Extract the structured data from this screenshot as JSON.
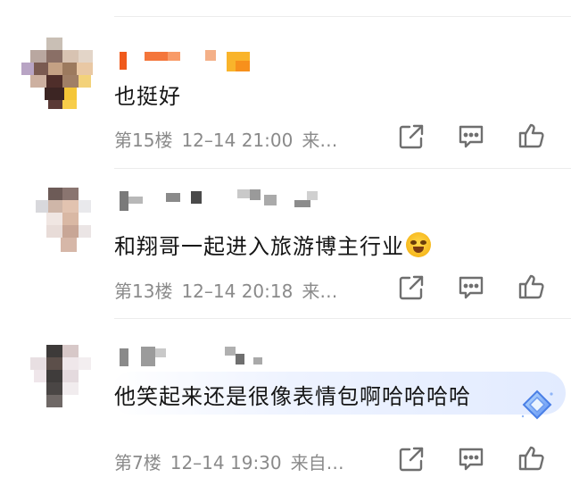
{
  "comments": [
    {
      "content": "也挺好",
      "floor": "第15楼",
      "time": "12–14 21:00",
      "source": "来…"
    },
    {
      "content": "和翔哥一起进入旅游博主行业",
      "floor": "第13楼",
      "time": "12–14 20:18",
      "source": "来…"
    },
    {
      "content": "他笑起来还是很像表情包啊哈哈哈哈",
      "floor": "第7楼",
      "time": "12–14 19:30",
      "source": "来自…"
    }
  ],
  "icons": {
    "share": "share-icon",
    "comment": "comment-icon",
    "like": "thumbs-up-icon",
    "emoji": "laughing-crying-emoji",
    "badge": "diamond-badge-icon"
  },
  "colors": {
    "meta_text": "#8a8a8a",
    "content_text": "#151515",
    "icon_stroke": "#6f6f6f",
    "highlight_bg": "#e2ebff",
    "username_orange": "#f05a1c"
  }
}
